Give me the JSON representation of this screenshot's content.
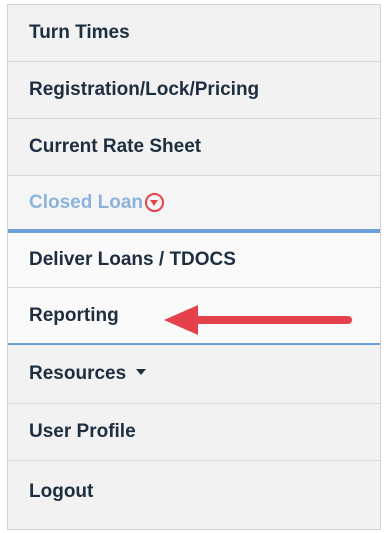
{
  "menu": {
    "items": [
      {
        "label": "Turn Times"
      },
      {
        "label": "Registration/Lock/Pricing"
      },
      {
        "label": "Current Rate Sheet"
      },
      {
        "label": "Closed Loan",
        "expanded": true,
        "color": "#8cb3dc"
      },
      {
        "label": "Deliver Loans / TDOCS"
      },
      {
        "label": "Reporting",
        "highlighted_by_arrow": true
      },
      {
        "label": "Resources"
      },
      {
        "label": "User Profile"
      },
      {
        "label": "Logout"
      }
    ]
  },
  "icons": {
    "closed_loan_toggle": "chevron-down-circle-icon",
    "resources_caret": "caret-down-icon",
    "annotation": "red-arrow-icon"
  },
  "colors": {
    "text": "#1c2e40",
    "active_section": "#8cb3dc",
    "accent_blue": "#6d9fd8",
    "annotation_red": "#e5414a",
    "background": "#f2f2f2"
  }
}
